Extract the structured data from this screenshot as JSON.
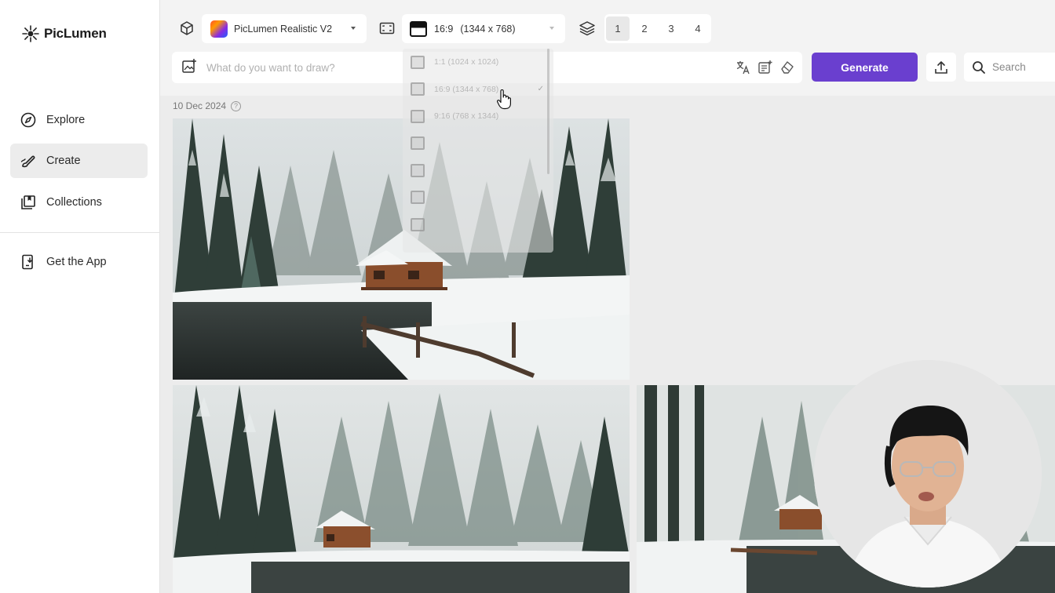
{
  "brand": {
    "name": "PicLumen"
  },
  "sidebar": {
    "items": [
      {
        "label": "Explore",
        "icon": "compass-icon",
        "active": false
      },
      {
        "label": "Create",
        "icon": "brush-icon",
        "active": true
      },
      {
        "label": "Collections",
        "icon": "collections-icon",
        "active": false
      }
    ],
    "secondary": [
      {
        "label": "Get the App",
        "icon": "phone-download-icon"
      }
    ]
  },
  "toolbar": {
    "model": {
      "label": "PicLumen Realistic V2",
      "icon": "model-cube-icon"
    },
    "aspect": {
      "ratio": "16:9",
      "size": "(1344 x 768)",
      "icon": "aspect-ratio-icon"
    },
    "batch": {
      "icon": "layers-icon",
      "options": [
        "1",
        "2",
        "3",
        "4"
      ],
      "selected": "1"
    },
    "prompt": {
      "placeholder": "What do you want to draw?"
    },
    "generate_label": "Generate",
    "search_placeholder": "Search"
  },
  "gallery": {
    "date": "10 Dec 2024"
  },
  "aspect_dropdown": {
    "options": [
      {
        "label": "1:1  (1024 x 1024)",
        "selected": false
      },
      {
        "label": "16:9  (1344 x 768)",
        "selected": true
      },
      {
        "label": "9:16  (768 x 1344)",
        "selected": false
      },
      {
        "label": "",
        "selected": false
      },
      {
        "label": "",
        "selected": false
      },
      {
        "label": "",
        "selected": false
      },
      {
        "label": "",
        "selected": false
      }
    ]
  },
  "colors": {
    "accent": "#6a3fcf",
    "sidebar_bg": "#ffffff",
    "content_bg": "#ececec"
  }
}
